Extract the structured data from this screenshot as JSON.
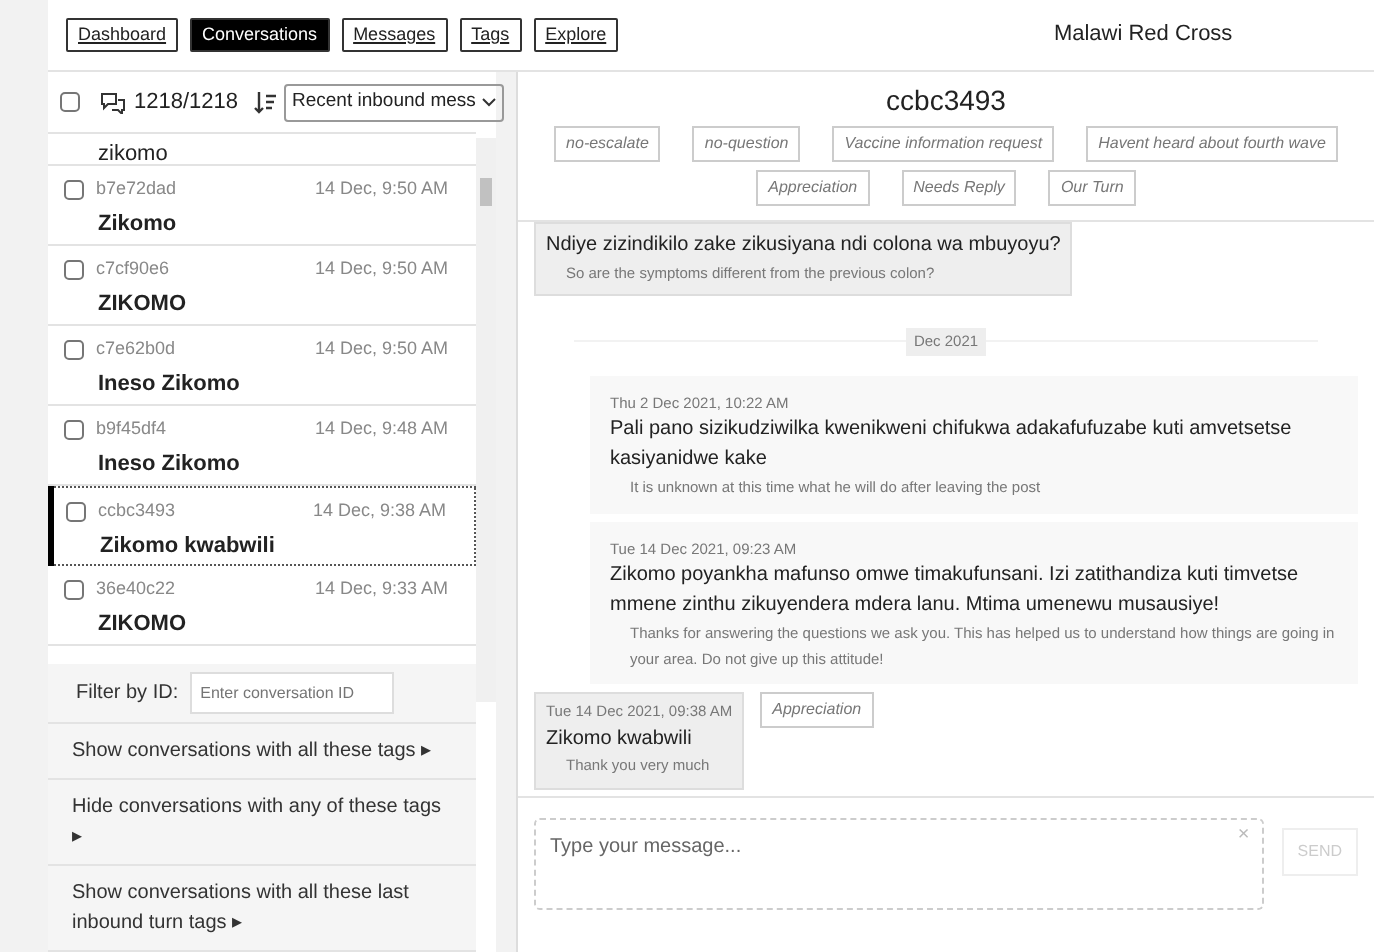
{
  "nav": {
    "tabs": [
      {
        "label": "Dashboard",
        "selected": false
      },
      {
        "label": "Conversations",
        "selected": true
      },
      {
        "label": "Messages",
        "selected": false
      },
      {
        "label": "Tags",
        "selected": false
      },
      {
        "label": "Explore",
        "selected": false
      }
    ],
    "org": "Malawi Red Cross"
  },
  "sidebar": {
    "select_all_checked": false,
    "count": "1218/1218",
    "sort": "Recent inbound mess",
    "conversations": [
      {
        "text": "zikomo",
        "selected": false
      },
      {
        "id": "b7e72dad",
        "time": "14 Dec, 9:50 AM",
        "text": "Zikomo",
        "selected": false,
        "checked": false
      },
      {
        "id": "c7cf90e6",
        "time": "14 Dec, 9:50 AM",
        "text": "ZIKOMO",
        "selected": false,
        "checked": false
      },
      {
        "id": "c7e62b0d",
        "time": "14 Dec, 9:50 AM",
        "text": "Ineso Zikomo",
        "selected": false,
        "checked": false
      },
      {
        "id": "b9f45df4",
        "time": "14 Dec, 9:48 AM",
        "text": "Ineso Zikomo",
        "selected": false,
        "checked": false
      },
      {
        "id": "ccbc3493",
        "time": "14 Dec, 9:38 AM",
        "text": "Zikomo kwabwili",
        "selected": true,
        "checked": false
      },
      {
        "id": "36e40c22",
        "time": "14 Dec, 9:33 AM",
        "text": "ZIKOMO",
        "selected": false,
        "checked": false
      }
    ],
    "filter_label": "Filter by ID:",
    "filter_placeholder": "Enter conversation ID",
    "filters": [
      "Show conversations with all these tags ▸",
      "Hide conversations with any of these tags ▸",
      "Show conversations with all these last inbound turn tags ▸"
    ]
  },
  "conversation": {
    "title": "ccbc3493",
    "tags": [
      "no-escalate",
      "no-question",
      "Vaccine information request",
      "Havent heard about fourth wave",
      "Appreciation",
      "Needs Reply",
      "Our Turn"
    ],
    "messages": [
      {
        "kind": "inbound",
        "text": "Ndiye zizindikilo zake zikusiyana ndi colona wa mbuyoyu?",
        "translation": "So are the symptoms different from the previous colon?"
      },
      {
        "kind": "divider",
        "text": "Dec 2021"
      },
      {
        "kind": "outbound",
        "time": "Thu 2 Dec 2021, 10:22 AM",
        "text": "Pali pano sizikudziwilka kwenikweni chifukwa adakafufuzabe kuti amvetsetse kasiyanidwe kake",
        "translation": "It is unknown at this time what he will do after leaving the post"
      },
      {
        "kind": "outbound",
        "time": "Tue 14 Dec 2021, 09:23 AM",
        "text": "Zikomo poyankha mafunso omwe timakufunsani. Izi zatithandiza kuti timvetse mmene zinthu zikuyendera mdera lanu. Mtima umenewu musausiye!",
        "translation": "Thanks for answering the questions we ask you. This has helped us to understand how things are going in your area. Do not give up this attitude!"
      },
      {
        "kind": "inbound",
        "time": "Tue 14 Dec 2021, 09:38 AM",
        "text": "Zikomo kwabwili",
        "translation": "Thank you very much",
        "tags": [
          "Appreciation"
        ]
      }
    ],
    "composer": {
      "placeholder": "Type your message...",
      "clear": "×",
      "send": "SEND"
    }
  }
}
